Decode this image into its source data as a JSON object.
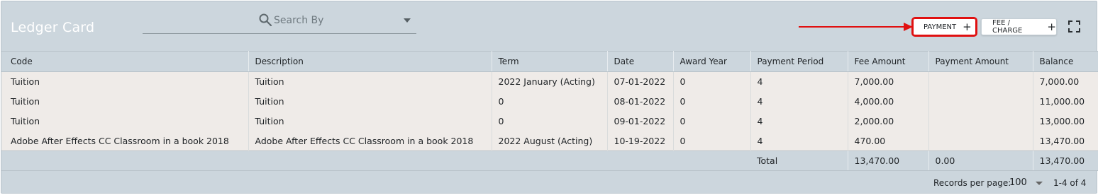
{
  "header": {
    "title": "Ledger Card",
    "search_placeholder": "Search By",
    "payment_label": "PAYMENT",
    "fee_label": "FEE / CHARGE",
    "plus": "+",
    "highlight_color": "#e01010"
  },
  "table": {
    "columns": [
      "Code",
      "Description",
      "Term",
      "Date",
      "Award Year",
      "Payment Period",
      "Fee Amount",
      "Payment Amount",
      "Balance"
    ],
    "rows": [
      [
        "Tuition",
        "Tuition",
        "2022 January (Acting)",
        "07-01-2022",
        "0",
        "4",
        "7,000.00",
        "",
        "7,000.00"
      ],
      [
        "Tuition",
        "Tuition",
        "0",
        "08-01-2022",
        "0",
        "4",
        "4,000.00",
        "",
        "11,000.00"
      ],
      [
        "Tuition",
        "Tuition",
        "0",
        "09-01-2022",
        "0",
        "4",
        "2,000.00",
        "",
        "13,000.00"
      ],
      [
        "Adobe After Effects CC Classroom in a book 2018",
        "Adobe After Effects CC Classroom in a book 2018",
        "2022 August (Acting)",
        "10-19-2022",
        "0",
        "4",
        "470.00",
        "",
        "13,470.00"
      ]
    ],
    "total": {
      "label": "Total",
      "fee_amount": "13,470.00",
      "payment_amount": "0.00",
      "balance": "13,470.00"
    }
  },
  "footer": {
    "records_per_page_label": "Records per page:",
    "records_per_page": "100",
    "range": "1-4 of 4"
  }
}
